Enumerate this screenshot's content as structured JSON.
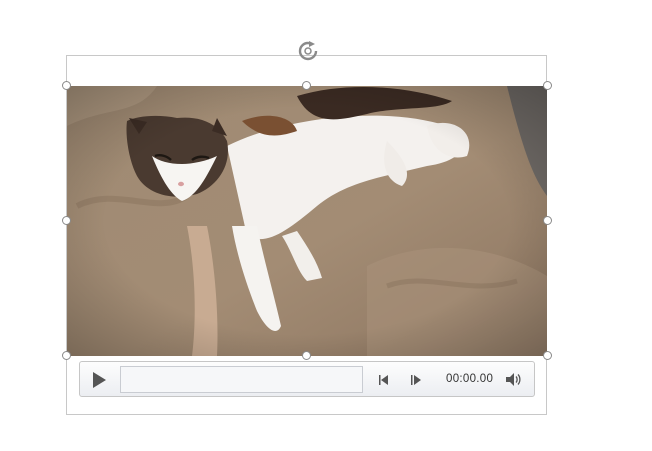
{
  "player": {
    "time": "00:00.00"
  },
  "icons": {
    "rotate": "rotate-icon",
    "play": "play-icon",
    "previous": "skip-back-icon",
    "next": "skip-forward-icon",
    "volume": "volume-icon"
  },
  "colors": {
    "selection_border": "#c8c8c8",
    "handle_border": "#8a8a8a",
    "control_icon": "#555555"
  }
}
